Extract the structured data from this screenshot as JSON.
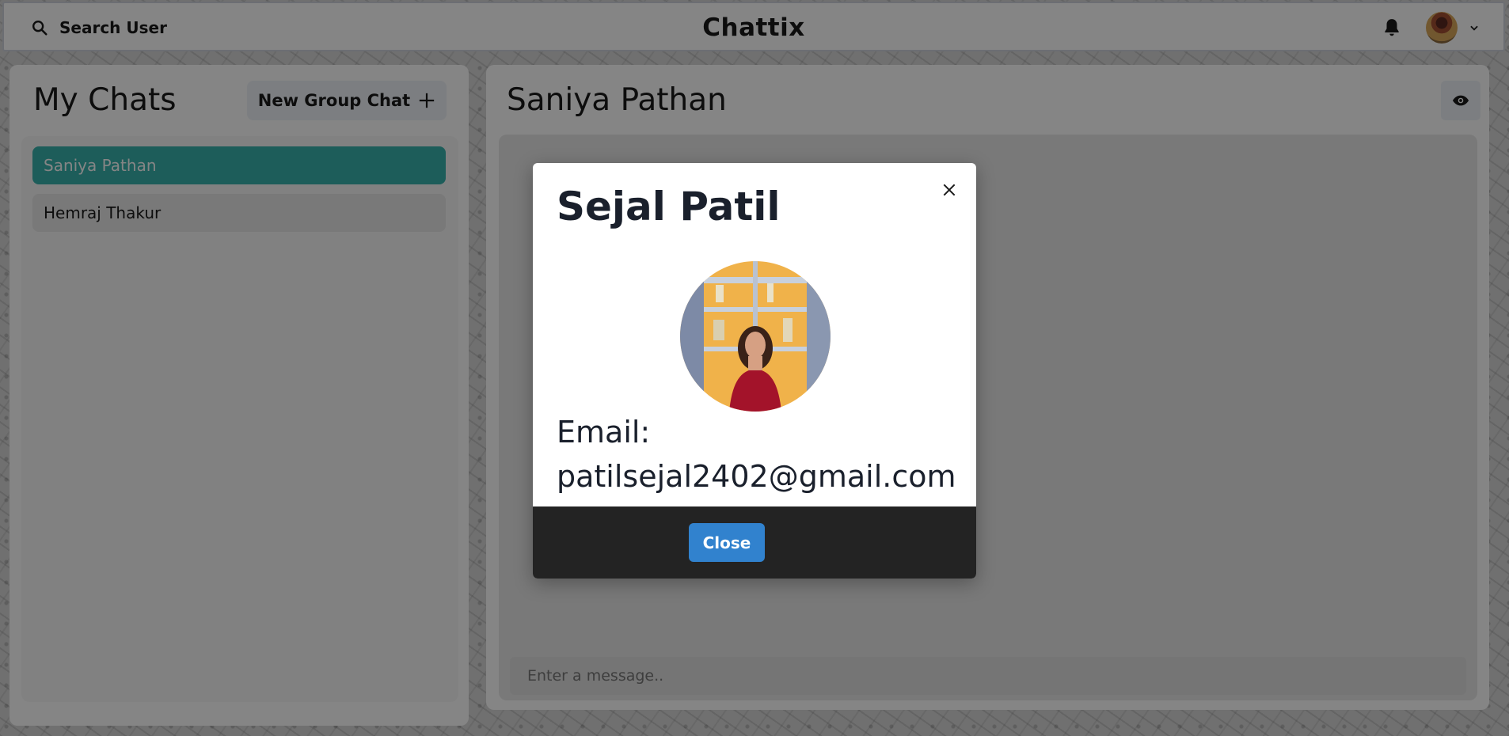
{
  "header": {
    "search_label": "Search User",
    "app_title": "Chattix",
    "icons": {
      "search": "search-icon",
      "bell": "bell-icon",
      "chevron": "chevron-down-icon"
    }
  },
  "sidebar": {
    "title": "My Chats",
    "new_group_label": "New Group Chat",
    "chats": [
      {
        "name": "Saniya Pathan",
        "active": true
      },
      {
        "name": "Hemraj Thakur",
        "active": false
      }
    ]
  },
  "conversation": {
    "title": "Saniya Pathan",
    "input_placeholder": "Enter a message.."
  },
  "modal": {
    "name": "Sejal Patil",
    "email_label": "Email:",
    "email": "patilsejal2402@gmail.com",
    "close_label": "Close"
  },
  "colors": {
    "active_chat": "#38b2ac",
    "close_button": "#3182ce",
    "modal_footer": "#232323"
  }
}
